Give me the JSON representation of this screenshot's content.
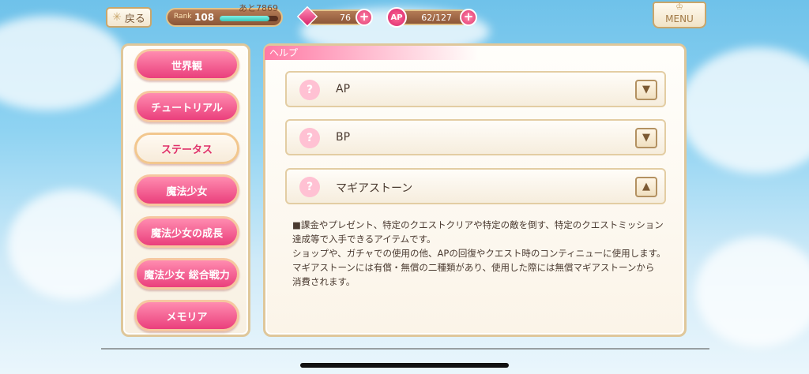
{
  "topbar": {
    "back_label": "戻る",
    "rank_label": "Rank",
    "rank_value": "108",
    "rank_next": "あと7869",
    "rank_progress": 0.85,
    "stones": "76",
    "ap_label": "AP",
    "ap_value": "62/127",
    "menu_label": "MENU"
  },
  "sidebar": {
    "items": [
      {
        "label": "世界観"
      },
      {
        "label": "チュートリアル"
      },
      {
        "label": "ステータス"
      },
      {
        "label": "魔法少女"
      },
      {
        "label": "魔法少女の成長"
      },
      {
        "label": "魔法少女 総合戦力"
      },
      {
        "label": "メモリア"
      }
    ],
    "active_index": 2
  },
  "help": {
    "tab_label": "ヘルプ",
    "accordions": [
      {
        "icon": "?",
        "title": "AP",
        "state": "collapsed"
      },
      {
        "icon": "?",
        "title": "BP",
        "state": "collapsed"
      },
      {
        "icon": "?",
        "title": "マギアストーン",
        "state": "expanded"
      }
    ],
    "description": [
      "■課金やプレゼント、特定のクエストクリアや特定の敵を倒す、特定のクエストミッション",
      "達成等で入手できるアイテムです。",
      "ショップや、ガチャでの使用の他、APの回復やクエスト時のコンティニューに使用します。",
      "マギアストーンには有償・無償の二種類があり、使用した際には無償マギアストーンから",
      "消費されます。"
    ]
  },
  "colors": {
    "accent_pink": "#ea3f7c",
    "frame_gold": "#dfc79a",
    "sky_blue": "#6fc2ea"
  }
}
